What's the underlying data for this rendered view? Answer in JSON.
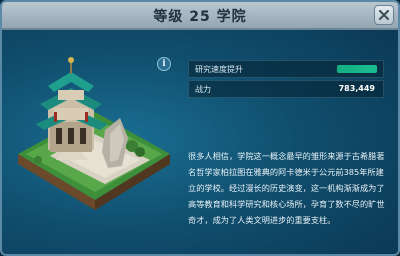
{
  "header": {
    "title": "等级 25 学院"
  },
  "stats": [
    {
      "label": "研究速度提升",
      "value": "",
      "bar_color": "#1fd49d"
    },
    {
      "label": "战力",
      "value": "783,449"
    }
  ],
  "description": "很多人相信，学院这一概念最早的雏形来源于古希腊著名哲学家柏拉图在雅典的阿卡德米于公元前385年所建立的学校。经过漫长的历史演变，这一机构渐渐成为了高等教育和科学研究和核心场所，孕育了数不尽的旷世奇才，成为了人类文明进步的重要支柱。",
  "icons": {
    "close": "close-icon",
    "info": "info-icon",
    "building": "academy-building-icon"
  },
  "colors": {
    "panel": "#104e6e",
    "roof": "#1a8a7a",
    "wall": "#c8bfb0",
    "grass": "#4fa044"
  }
}
